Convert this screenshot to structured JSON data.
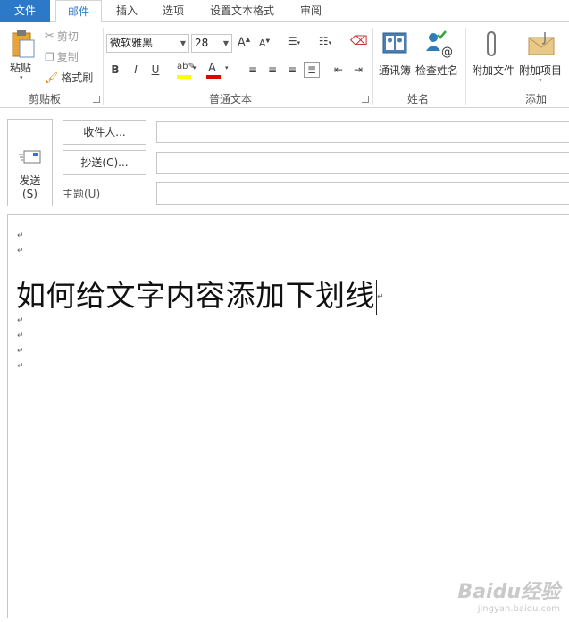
{
  "tabs": [
    {
      "label": "文件"
    },
    {
      "label": "邮件"
    },
    {
      "label": "插入"
    },
    {
      "label": "选项"
    },
    {
      "label": "设置文本格式"
    },
    {
      "label": "审阅"
    }
  ],
  "ribbon": {
    "clipboard": {
      "paste": "粘贴",
      "cut": "剪切",
      "copy": "复制",
      "format_painter": "格式刷",
      "group": "剪贴板"
    },
    "basic_text": {
      "font": "微软雅黑",
      "size": "28",
      "grow_icon": "A",
      "shrink_icon": "A",
      "bold": "B",
      "italic": "I",
      "underline": "U",
      "font_color_letter": "A",
      "group": "普通文本"
    },
    "names": {
      "address_book": "通讯簿",
      "check_names": "检查姓名",
      "group": "姓名"
    },
    "include": {
      "attach_file": "附加文件",
      "attach_item": "附加项目",
      "group": "添加"
    }
  },
  "header": {
    "send_label": "发送",
    "send_key": "(S)",
    "to_button": "收件人...",
    "cc_button": "抄送(C)...",
    "subject_label": "主题(U)",
    "to_value": "",
    "cc_value": "",
    "subject_value": ""
  },
  "body": {
    "headline": "如何给文字内容添加下划线",
    "para_mark": "↵"
  },
  "watermark": {
    "brand": "Baidu经验",
    "url": "jingyan.baidu.com"
  },
  "colors": {
    "accent": "#2b79c8",
    "highlight_yellow": "#ffff00",
    "font_color_red": "#e00000"
  }
}
